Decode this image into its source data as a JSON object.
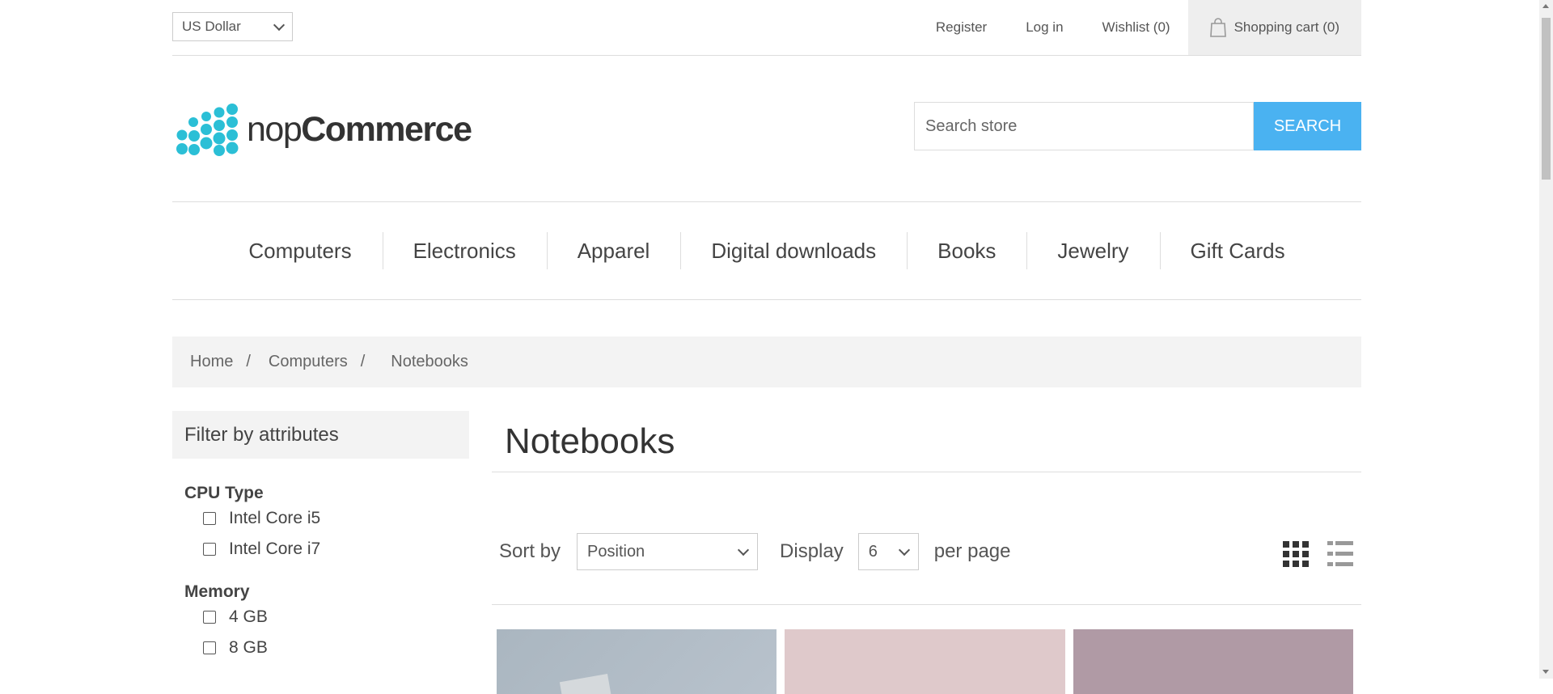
{
  "header": {
    "currency": "US Dollar",
    "links": {
      "register": "Register",
      "login": "Log in",
      "wishlist": "Wishlist (0)",
      "cart": "Shopping cart (0)"
    }
  },
  "logo": {
    "prefix": "nop",
    "suffix": "Commerce"
  },
  "search": {
    "placeholder": "Search store",
    "button": "SEARCH"
  },
  "menu": [
    "Computers",
    "Electronics",
    "Apparel",
    "Digital downloads",
    "Books",
    "Jewelry",
    "Gift Cards"
  ],
  "breadcrumb": {
    "home": "Home",
    "sep": "/",
    "parent": "Computers",
    "current": "Notebooks"
  },
  "filter": {
    "title": "Filter by attributes",
    "groups": [
      {
        "name": "CPU Type",
        "options": [
          "Intel Core i5",
          "Intel Core i7"
        ]
      },
      {
        "name": "Memory",
        "options": [
          "4 GB",
          "8 GB"
        ]
      }
    ]
  },
  "category": {
    "title": "Notebooks",
    "sort_label": "Sort by",
    "sort_value": "Position",
    "display_label": "Display",
    "page_size": "6",
    "per_page_label": "per page"
  },
  "colors": {
    "accent": "#4ab2f1",
    "logo_dots": "#2bbfd6"
  },
  "icons": [
    "cart-bag-icon",
    "grid-view-icon",
    "list-view-icon"
  ]
}
